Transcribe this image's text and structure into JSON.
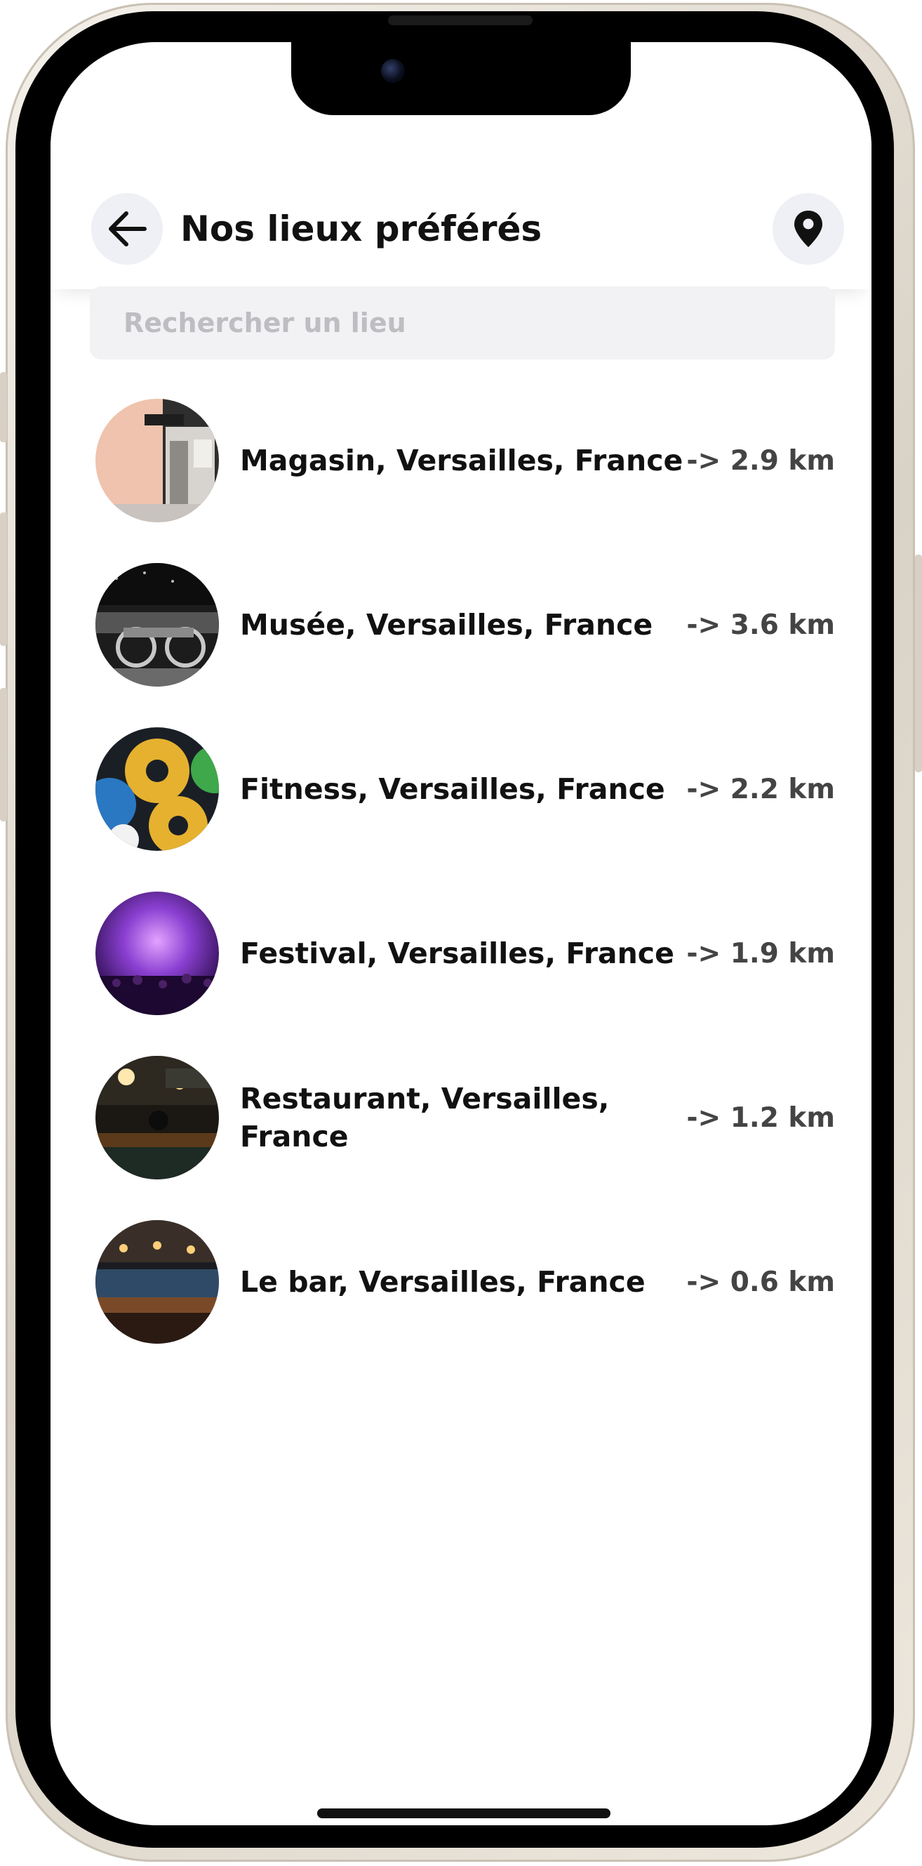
{
  "header": {
    "title": "Nos lieux préférés",
    "back_icon": "arrow-left-icon",
    "location_icon": "map-pin-icon"
  },
  "search": {
    "placeholder": "Rechercher un lieu",
    "value": ""
  },
  "places": [
    {
      "name": "Magasin, Versailles, France",
      "distance": "-> 2.9 km",
      "image": "shop-storefront-photo"
    },
    {
      "name": "Musée, Versailles, France",
      "distance": "-> 3.6 km",
      "image": "museum-vintage-car-photo"
    },
    {
      "name": "Fitness, Versailles, France",
      "distance": "-> 2.2 km",
      "image": "fitness-weight-plates-photo"
    },
    {
      "name": "Festival, Versailles, France",
      "distance": "-> 1.9 km",
      "image": "festival-concert-crowd-photo"
    },
    {
      "name": "Restaurant, Versailles, France",
      "distance": "-> 1.2 km",
      "image": "restaurant-interior-photo"
    },
    {
      "name": "Le bar, Versailles, France",
      "distance": "-> 0.6 km",
      "image": "bar-counter-photo"
    }
  ],
  "colors": {
    "icon_button_bg": "#eef0f5",
    "search_bg": "#f2f2f4",
    "placeholder": "#bdbdc2",
    "text_primary": "#111111",
    "text_distance": "#444444"
  }
}
